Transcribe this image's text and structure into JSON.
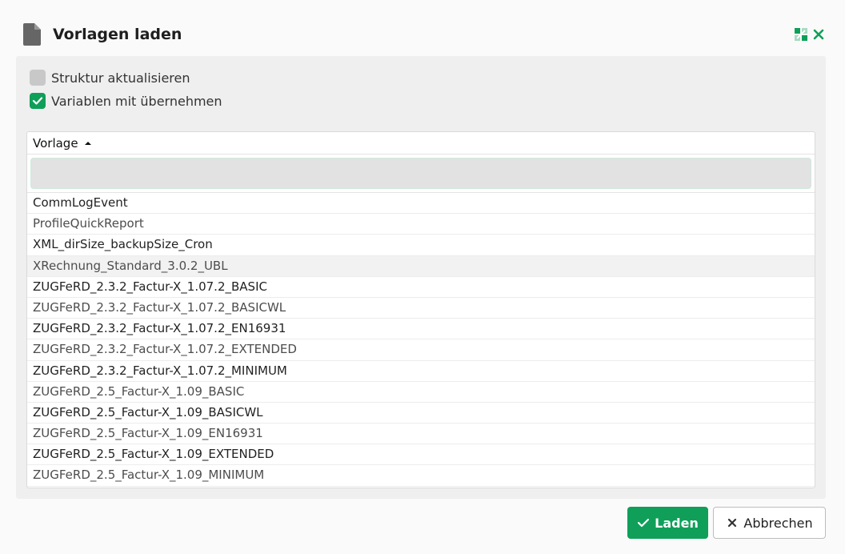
{
  "dialog": {
    "title": "Vorlagen laden",
    "icons": {
      "document": "file-icon",
      "expand": "expand-icon",
      "close": "close-icon"
    },
    "accent_color": "#0f9f59"
  },
  "options": [
    {
      "label": "Struktur aktualisieren",
      "checked": false
    },
    {
      "label": "Variablen mit übernehmen",
      "checked": true
    }
  ],
  "grid": {
    "column_header": "Vorlage",
    "sort": "ascending",
    "filter_value": "",
    "rows": [
      "CommLogEvent",
      "ProfileQuickReport",
      "XML_dirSize_backupSize_Cron",
      "XRechnung_Standard_3.0.2_UBL",
      "ZUGFeRD_2.3.2_Factur-X_1.07.2_BASIC",
      "ZUGFeRD_2.3.2_Factur-X_1.07.2_BASICWL",
      "ZUGFeRD_2.3.2_Factur-X_1.07.2_EN16931",
      "ZUGFeRD_2.3.2_Factur-X_1.07.2_EXTENDED",
      "ZUGFeRD_2.3.2_Factur-X_1.07.2_MINIMUM",
      "ZUGFeRD_2.5_Factur-X_1.09_BASIC",
      "ZUGFeRD_2.5_Factur-X_1.09_BASICWL",
      "ZUGFeRD_2.5_Factur-X_1.09_EN16931",
      "ZUGFeRD_2.5_Factur-X_1.09_EXTENDED",
      "ZUGFeRD_2.5_Factur-X_1.09_MINIMUM"
    ]
  },
  "buttons": {
    "load": "Laden",
    "cancel": "Abbrechen"
  }
}
